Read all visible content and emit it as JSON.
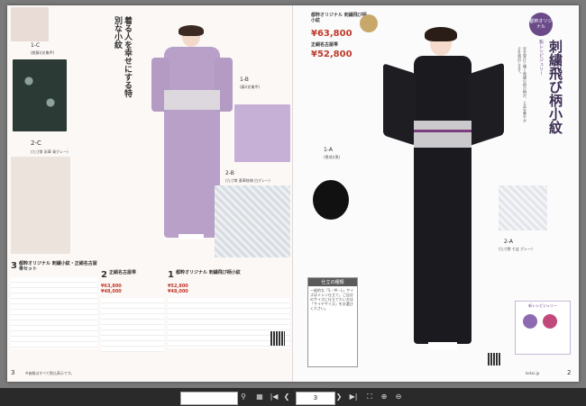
{
  "left_page": {
    "headline": "着る人を幸せにする特別な小紋",
    "swatch_1c": {
      "code": "1-C",
      "desc": "(紺藤)(花亀甲)"
    },
    "swatch_2c": {
      "code": "2-C",
      "desc": "(九寸帯 彩華 青グレー)"
    },
    "item_1b": {
      "code": "1-B",
      "desc": "(藤)(花亀甲)"
    },
    "item_2b": {
      "code": "2-B",
      "desc": "(九寸帯 菱華紋様 白グレー)"
    },
    "product_3": {
      "num": "3",
      "title": "都粋オリジナル 刺繍小紋・正絹名古屋帯セット"
    },
    "product_2": {
      "num": "2",
      "title": "正絹名古屋帯",
      "price_a": "¥63,800",
      "price_b": "¥48,000"
    },
    "product_1": {
      "num": "1",
      "title": "都粋オリジナル 刺繍飛び柄小紋",
      "price_a": "¥52,800",
      "price_b": "¥48,000"
    },
    "page_num": "3",
    "footer": "※価格はすべて税込表示です。"
  },
  "right_page": {
    "badge": "都粋オリジナル",
    "category": "新レシピジュリー",
    "headline": "刺繍飛び柄小紋",
    "desc": "光を受けて輝く刺繍の飛び柄が、上品な華やかさを演出します。",
    "card_title": "都粋オリジナル 刺繍飛び柄小紋",
    "price1": "¥63,800",
    "price1_label": "正絹名古屋帯",
    "price2": "¥52,800",
    "item_1a": {
      "code": "1-A",
      "desc": "(黒地)(黒)"
    },
    "item_2a": {
      "code": "2-A",
      "desc": "(九寸帯 七宝 グレー)"
    },
    "size_box_title": "仕立の種類",
    "size_box_text": "一般的な「S・M・L」サイズはミシン仕立て。ご自分のサイズに仕立てたい方は「サイヤサイズ」をお選びください。",
    "recipe_label": "新レシピジュリー",
    "page_num": "2",
    "url": "kokui.jp"
  },
  "toolbar": {
    "search_placeholder": "",
    "page_value": "3"
  },
  "colors": {
    "lavender": "#b8a0c8",
    "black_kimono": "#1b1b1f",
    "accent_red": "#c0392b",
    "purple": "#6b4a8a"
  }
}
